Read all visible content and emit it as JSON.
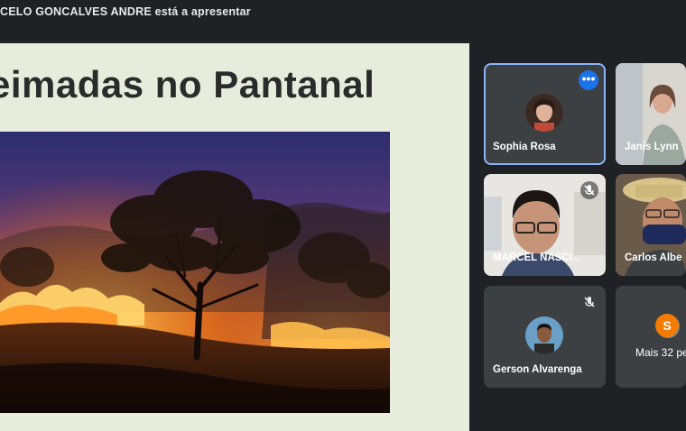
{
  "header": {
    "presenter_name": "CELO GONCALVES ANDRE",
    "presenting_suffix": "está a apresentar"
  },
  "slide": {
    "title": "eimadas no Pantanal"
  },
  "participants": [
    {
      "name": "Sophia Rosa"
    },
    {
      "name": "Janis Lynn"
    },
    {
      "name": "MARCEL NASCI..."
    },
    {
      "name": "Carlos Albe"
    },
    {
      "name": "Gerson Alvarenga"
    }
  ],
  "overflow": {
    "label": "Mais 32 pe",
    "avatar_initial": "S"
  },
  "colors": {
    "accent": "#8ab4f8",
    "more_button": "#1a73e8",
    "overflow_avatar": "#f57c00",
    "tile_bg": "#3c4043"
  }
}
